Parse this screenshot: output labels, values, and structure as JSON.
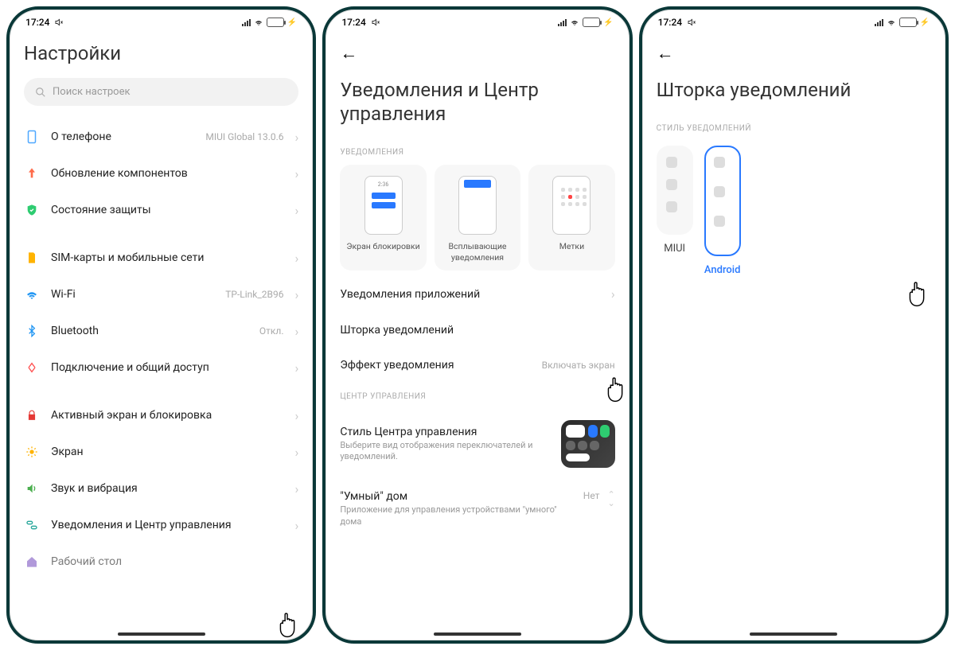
{
  "statusbar": {
    "time": "17:24",
    "charge_symbol": "⚡"
  },
  "screen1": {
    "title": "Настройки",
    "search_placeholder": "Поиск настроек",
    "items": {
      "about": {
        "label": "О телефоне",
        "value": "MIUI Global 13.0.6"
      },
      "update": {
        "label": "Обновление компонентов"
      },
      "security": {
        "label": "Состояние защиты"
      },
      "sim": {
        "label": "SIM-карты и мобильные сети"
      },
      "wifi": {
        "label": "Wi-Fi",
        "value": "TP-Link_2B96"
      },
      "bluetooth": {
        "label": "Bluetooth",
        "value": "Откл."
      },
      "share": {
        "label": "Подключение и общий доступ"
      },
      "lock": {
        "label": "Активный экран и блокировка"
      },
      "display": {
        "label": "Экран"
      },
      "sound": {
        "label": "Звук и вибрация"
      },
      "notif": {
        "label": "Уведомления и Центр управления"
      },
      "home": {
        "label": "Рабочий стол"
      }
    }
  },
  "screen2": {
    "title": "Уведомления и Центр управления",
    "section_notif": "УВЕДОМЛЕНИЯ",
    "section_cc": "ЦЕНТР УПРАВЛЕНИЯ",
    "tiles": {
      "lock": {
        "label": "Экран блокировки",
        "time": "2:36"
      },
      "popup": {
        "label": "Всплывающие уведомления"
      },
      "badges": {
        "label": "Метки"
      }
    },
    "items": {
      "apps": {
        "label": "Уведомления приложений"
      },
      "shade": {
        "label": "Шторка уведомлений"
      },
      "effect": {
        "label": "Эффект уведомления",
        "value": "Включать экран"
      },
      "cc_style": {
        "label": "Стиль Центра управления",
        "desc": "Выберите вид отображения переключателей и уведомлений."
      },
      "smart": {
        "label": "\"Умный\" дом",
        "desc": "Приложение для управления устройствами \"умного\" дома",
        "value": "Нет"
      }
    }
  },
  "screen3": {
    "title": "Шторка уведомлений",
    "section": "СТИЛЬ УВЕДОМЛЕНИЙ",
    "options": {
      "miui": "MIUI",
      "android": "Android"
    }
  }
}
